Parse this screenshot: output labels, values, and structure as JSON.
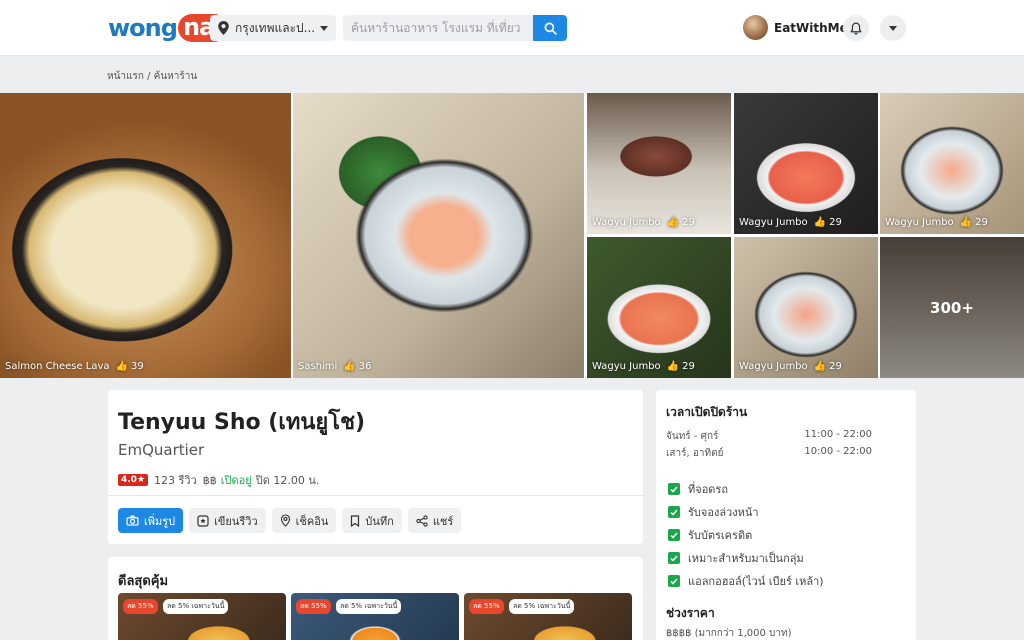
{
  "header": {
    "logo_left": "wong",
    "logo_right": "nai",
    "location": "กรุงเทพและป...",
    "search_placeholder": "ค้นหาร้านอาหาร โรงแรม ที่เที่ยว",
    "username": "EatWithMe"
  },
  "breadcrumb": "หน้าแรก / ค้นหาร้าน",
  "gallery": [
    {
      "caption": "Salmon Cheese Lava",
      "likes": "39"
    },
    {
      "caption": "Sashimi",
      "likes": "36"
    },
    {
      "caption": "Wagyu Jumbo",
      "likes": "29"
    },
    {
      "caption": "Wagyu Jumbo",
      "likes": "29"
    },
    {
      "caption": "Wagyu Jumbo",
      "likes": "29"
    },
    {
      "caption": "Wagyu Jumbo",
      "likes": "29"
    },
    {
      "caption": "Wagyu Jumbo",
      "likes": "29"
    },
    {
      "more": "300+"
    }
  ],
  "restaurant": {
    "name": "Tenyuu Sho (เทนยูโช)",
    "branch": "EmQuartier",
    "rating": "4.0★",
    "reviews": "123 รีวิว",
    "price_symbol": "฿฿",
    "status": "เปิดอยู่",
    "closing": "ปิด 12.00 น."
  },
  "actions": {
    "add_photo": "เพิ่มรูป",
    "write_review": "เขียนรีวิว",
    "checkin": "เช็คอิน",
    "save": "บันทึก",
    "share": "แชร์"
  },
  "deals": {
    "title": "ดีลสุดคุ้ม",
    "badge_discount": "ลด 55%",
    "badge_today": "ลด 5% เฉพาะวันนี้"
  },
  "hours": {
    "title": "เวลาเปิดปิดร้าน",
    "rows": [
      {
        "days": "จันทร์ - ศุกร์",
        "time": "11:00 - 22:00"
      },
      {
        "days": "เสาร์, อาทิตย์",
        "time": "10:00 - 22:00"
      }
    ]
  },
  "features": [
    "ที่จอดรถ",
    "รับจองล่วงหน้า",
    "รับบัตรเครดิต",
    "เหมาะสำหรับมาเป็นกลุ่ม",
    "แอลกอฮอล์(ไวน์ เบียร์ เหล้า)"
  ],
  "price_range": {
    "title": "ช่วงราคา",
    "value": "฿฿฿฿ (มากกว่า 1,000 บาท)"
  },
  "colors": {
    "brand_blue": "#1e7ac0",
    "brand_red": "#e8472d",
    "primary": "#1e88e5",
    "green": "#1aa64b"
  }
}
